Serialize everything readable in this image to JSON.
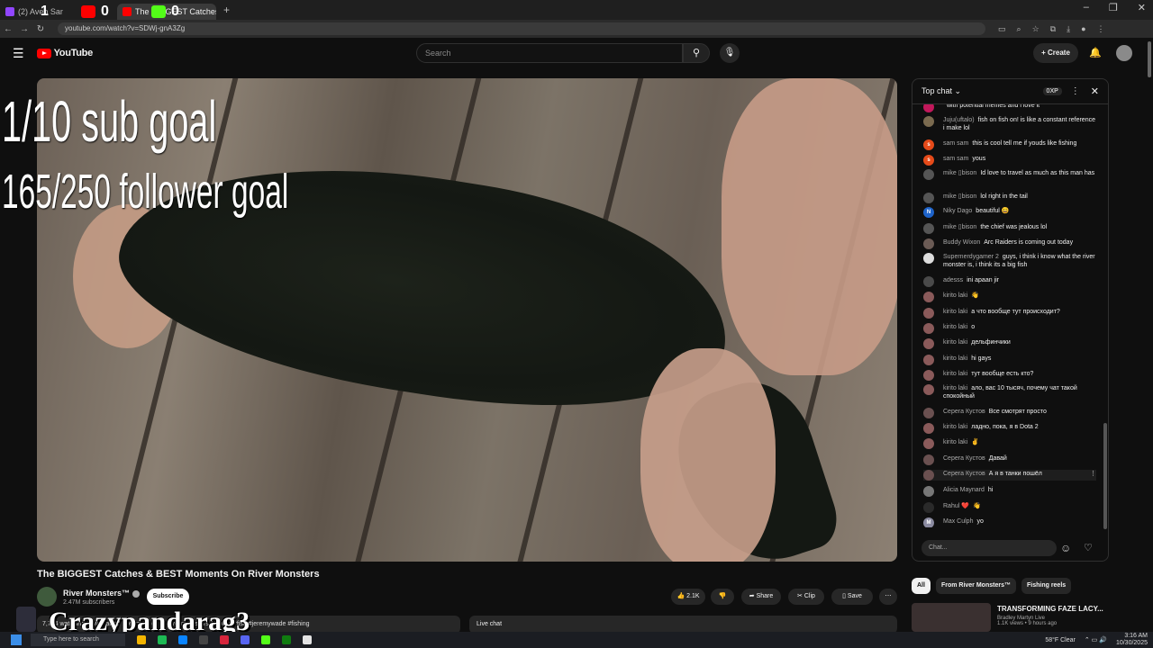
{
  "browser": {
    "tabs": [
      {
        "title": "(2) Aven Sanctuary - Twit",
        "color": "#9146ff"
      },
      {
        "title": "The BIGGEST Catches",
        "color": "#ff0000"
      }
    ],
    "url": "youtube.com/watch?v=SDWj-gnA3Zg"
  },
  "overlay_counters": [
    {
      "icon": "youtube-icon",
      "color": "#ff0000",
      "value": "0"
    },
    {
      "icon": "kick-icon",
      "color": "#53fc18",
      "value": "0"
    }
  ],
  "overlay_first_num": "1",
  "youtube": {
    "logo": "YouTube",
    "search_placeholder": "Search",
    "create_label": "Create"
  },
  "video": {
    "goal_sub": "1/10 sub goal",
    "goal_follower": "165/250 follower goal",
    "title": "The BIGGEST Catches & BEST Moments On River Monsters",
    "channel": "River Monsters™",
    "subscribers": "2.47M subscribers",
    "subscribe_label": "Subscribe",
    "likes": "2.1K",
    "share_label": "Share",
    "clip_label": "Clip",
    "save_label": "Save",
    "description": "7,784 watching now  Started streaming on ...  #rivermonsters #monsterfish #jeremywade #fishing",
    "live_chat_label": "Live chat",
    "streamer_overlay": "Crazypandarag3"
  },
  "chat": {
    "header": "Top chat",
    "xp": "0XP",
    "input_placeholder": "Chat...",
    "messages": [
      {
        "author": "",
        "text": "with potential memes and i love it",
        "avatar_color": "#c2185b",
        "initial": ""
      },
      {
        "author": "Juju(uftalo)",
        "text": "fish on fish on! is like a constant reference i make lol",
        "avatar_color": "#7a6a4f",
        "initial": ""
      },
      {
        "author": "sam sam",
        "text": "this is cool tell me if youds like fishing",
        "avatar_color": "#e64a19",
        "initial": "s"
      },
      {
        "author": "sam sam",
        "text": "yous",
        "avatar_color": "#e64a19",
        "initial": "s"
      },
      {
        "author": "mike ▯bison",
        "text": "Id love to travel as much as this man has",
        "avatar_color": "#555",
        "initial": ""
      },
      {
        "author": "mike ▯bison",
        "text": "lol right in the tail",
        "avatar_color": "#555",
        "initial": ""
      },
      {
        "author": "Niky Dago",
        "text": "beautiful 😀",
        "avatar_color": "#1e63c9",
        "initial": "N"
      },
      {
        "author": "mike ▯bison",
        "text": "the chief was jealous lol",
        "avatar_color": "#555",
        "initial": ""
      },
      {
        "author": "Buddy Wixon",
        "text": "Arc Raiders is coming out today",
        "avatar_color": "#6b5b55",
        "initial": ""
      },
      {
        "author": "Supernerdygamer 2",
        "text": "guys, i think i know what the river monster is, i think its a big fish",
        "avatar_color": "#ddd",
        "initial": ""
      },
      {
        "author": "adesss",
        "text": "ini apaan jir",
        "avatar_color": "#4a4a4a",
        "initial": ""
      },
      {
        "author": "kirito laki",
        "text": "👋",
        "avatar_color": "#8a5a5a",
        "initial": ""
      },
      {
        "author": "kirito laki",
        "text": "а что вообще тут происходит?",
        "avatar_color": "#8a5a5a",
        "initial": ""
      },
      {
        "author": "kirito laki",
        "text": "о",
        "avatar_color": "#8a5a5a",
        "initial": ""
      },
      {
        "author": "kirito laki",
        "text": "дельфинчики",
        "avatar_color": "#8a5a5a",
        "initial": ""
      },
      {
        "author": "kirito laki",
        "text": "hi gays",
        "avatar_color": "#8a5a5a",
        "initial": ""
      },
      {
        "author": "kirito laki",
        "text": "тут вообще есть кто?",
        "avatar_color": "#8a5a5a",
        "initial": ""
      },
      {
        "author": "kirito laki",
        "text": "ало, вас 10 тысяч, почему чат такой спокойный",
        "avatar_color": "#8a5a5a",
        "initial": ""
      },
      {
        "author": "Серега Кустов",
        "text": "Все смотрят просто",
        "avatar_color": "#6a5050",
        "initial": ""
      },
      {
        "author": "kirito laki",
        "text": "ладно, пока, я в Dota 2",
        "avatar_color": "#8a5a5a",
        "initial": ""
      },
      {
        "author": "kirito laki",
        "text": "✌️",
        "avatar_color": "#8a5a5a",
        "initial": ""
      },
      {
        "author": "Серега Кустов",
        "text": "Давай",
        "avatar_color": "#6a5050",
        "initial": ""
      },
      {
        "author": "Серега Кустов",
        "text": "А я в танки пошёл",
        "avatar_color": "#6a5050",
        "initial": ""
      },
      {
        "author": "Alicia Maynard",
        "text": "hi",
        "avatar_color": "#777",
        "initial": ""
      },
      {
        "author": "Rahul ❤️",
        "text": "👋",
        "avatar_color": "#2a2a2a",
        "initial": ""
      },
      {
        "author": "Max Culph",
        "text": "yo",
        "avatar_color": "#8a8aa0",
        "initial": "M"
      }
    ]
  },
  "chips": [
    "All",
    "From River Monsters™",
    "Fishing reels"
  ],
  "recommendation": {
    "title": "TRANSFORMING FAZE LACY...",
    "channel": "Bradley Martyn Live",
    "meta": "1.1K views • 9 hours ago"
  },
  "taskbar": {
    "search_placeholder": "Type here to search",
    "weather": "58°F  Clear",
    "time": "3:16 AM",
    "date": "10/30/2025"
  }
}
